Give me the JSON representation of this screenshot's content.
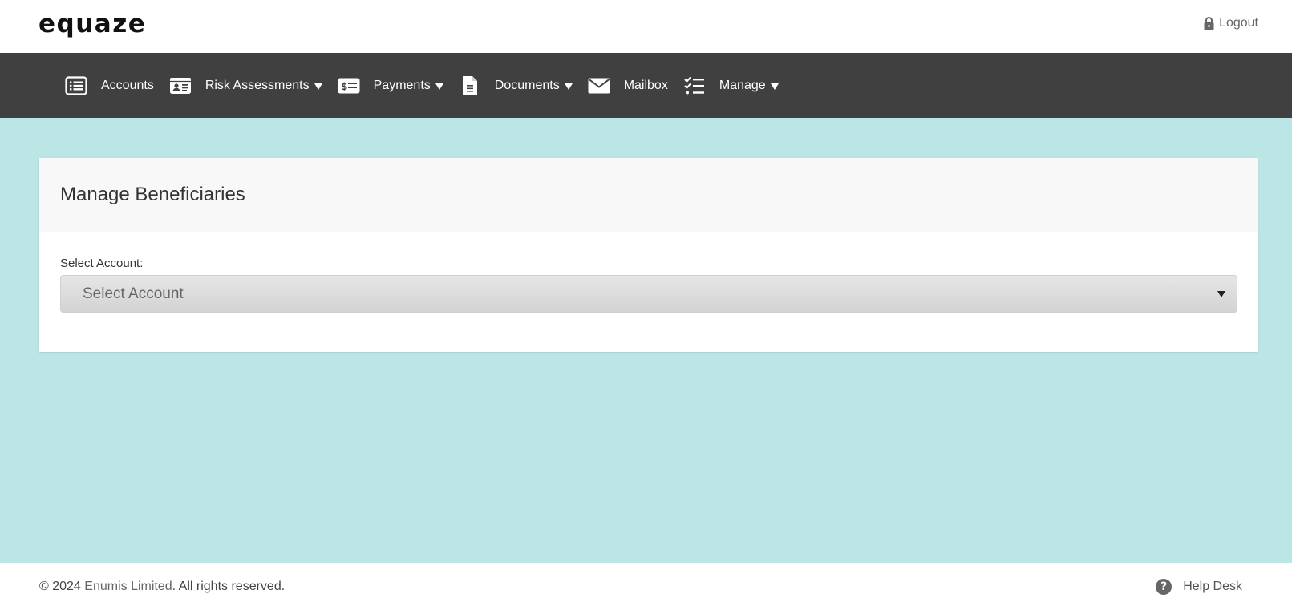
{
  "header": {
    "logo_text": "equaze",
    "logout_label": "Logout"
  },
  "nav": {
    "items": [
      {
        "label": "Accounts",
        "icon": "list-icon",
        "has_dropdown": false
      },
      {
        "label": "Risk Assessments",
        "icon": "id-card-icon",
        "has_dropdown": true
      },
      {
        "label": "Payments",
        "icon": "money-check-icon",
        "has_dropdown": true
      },
      {
        "label": "Documents",
        "icon": "document-icon",
        "has_dropdown": true
      },
      {
        "label": "Mailbox",
        "icon": "envelope-icon",
        "has_dropdown": false
      },
      {
        "label": "Manage",
        "icon": "checklist-icon",
        "has_dropdown": true
      }
    ]
  },
  "main": {
    "title": "Manage Beneficiaries",
    "account_label": "Select Account:",
    "account_select_value": "Select Account"
  },
  "footer": {
    "copyright_prefix": "© 2024 ",
    "company_name": "Enumis Limited",
    "copyright_suffix": ". All rights reserved.",
    "help_desk_label": "Help Desk",
    "help_icon_glyph": "?"
  },
  "colors": {
    "page_background": "#bce6e6",
    "nav_background": "#404040",
    "panel_header_background": "#f8f8f8"
  }
}
